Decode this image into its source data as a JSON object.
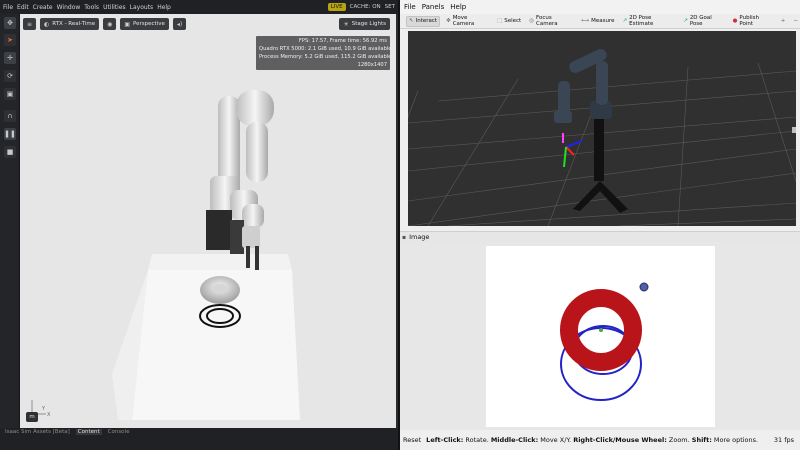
{
  "isaac": {
    "menu": [
      "File",
      "Edit",
      "Create",
      "Window",
      "Tools",
      "Utilities",
      "Layouts",
      "Help"
    ],
    "live_label": "LIVE",
    "cache_label": "CACHE: ON",
    "set_label": "SET",
    "viewport": {
      "render_mode": "RTX - Real-Time",
      "camera": "Perspective",
      "stage_lights": "Stage Lights",
      "stats": [
        "FPS: 17.57, Frame time: 56.92 ms",
        "Quadro RTX 5000: 2.1 GiB used, 10.9 GiB available",
        "Process Memory: 5.2 GiB used, 115.2 GiB available",
        "1280x1407"
      ],
      "axis_y": "Y",
      "axis_x": "X",
      "unit_badge": "m"
    },
    "bottom_tabs": [
      "Isaac Sim Assets [Beta]",
      "Content",
      "Console"
    ]
  },
  "rviz": {
    "menu": [
      "File",
      "Panels",
      "Help"
    ],
    "tools": [
      "Interact",
      "Move Camera",
      "Select",
      "Focus Camera",
      "Measure",
      "2D Pose Estimate",
      "2D Goal Pose",
      "Publish Point"
    ],
    "image_panel_title": "Image",
    "status": {
      "reset": "Reset",
      "left_click": "Left-Click:",
      "left_click_action": " Rotate. ",
      "middle_click": "Middle-Click:",
      "middle_click_action": " Move X/Y. ",
      "right_click": "Right-Click/Mouse Wheel:",
      "right_click_action": " Zoom. ",
      "shift": "Shift:",
      "shift_action": " More options.",
      "fps": "31 fps"
    }
  },
  "colors": {
    "live_badge": "#b8a40e",
    "torus_red": "#b81419",
    "ring_blue": "#2323c8",
    "viewport_bg": "#e6e6e6",
    "rviz_bg": "#303030"
  }
}
